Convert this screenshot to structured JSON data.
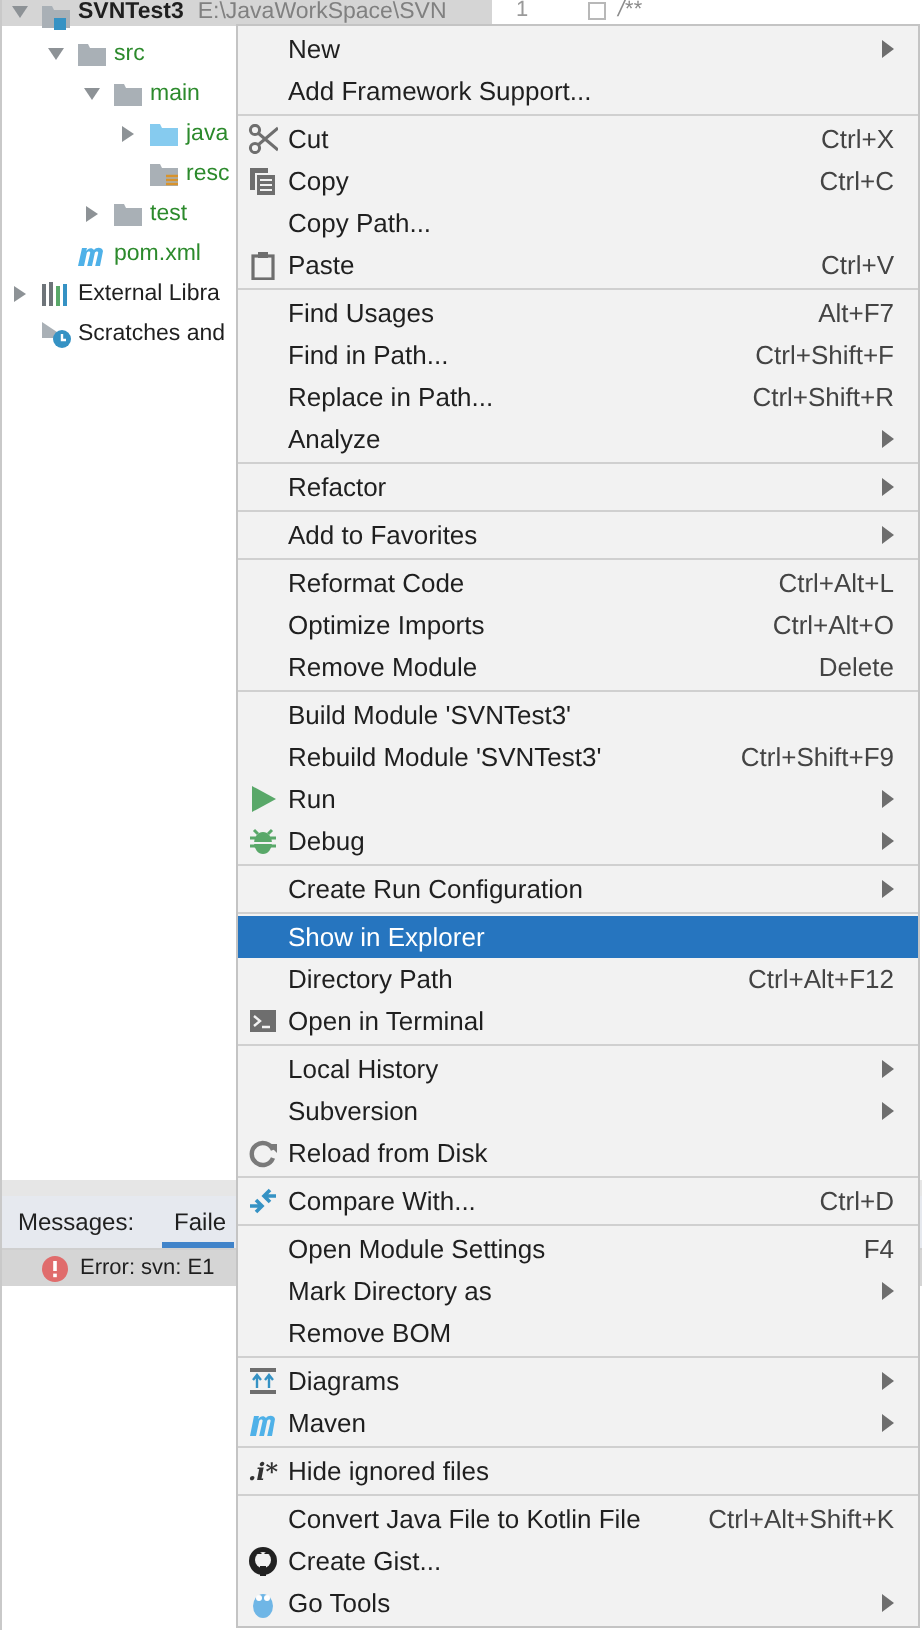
{
  "project_tree": [
    {
      "label": "SVNTest3",
      "path": "E:\\JavaWorkSpace\\SVN",
      "kind": "module",
      "color": "#1f1f1f",
      "expanded": true,
      "selected": true,
      "children": [
        {
          "label": "src",
          "kind": "folder",
          "color": "#2c8a2c",
          "expanded": true,
          "selected": false,
          "children": [
            {
              "label": "main",
              "kind": "folder",
              "color": "#2c8a2c",
              "expanded": true,
              "selected": false,
              "children": [
                {
                  "label": "java",
                  "kind": "source",
                  "color": "#2c8a2c",
                  "expanded": false,
                  "selected": false
                },
                {
                  "label": "resc",
                  "kind": "resources",
                  "color": "#2c8a2c",
                  "selected": false
                }
              ]
            },
            {
              "label": "test",
              "kind": "folder",
              "color": "#2c8a2c",
              "expanded": false,
              "selected": false
            }
          ]
        },
        {
          "label": "pom.xml",
          "kind": "maven",
          "color": "#2c8a2c",
          "selected": false
        }
      ]
    },
    {
      "label": "External Libra",
      "kind": "libraries",
      "color": "#1f1f1f",
      "expanded": false,
      "selected": false
    },
    {
      "label": "Scratches and",
      "kind": "scratches",
      "color": "#1f1f1f",
      "selected": false
    }
  ],
  "editor": {
    "line_number": "1",
    "code": "/**"
  },
  "messages_panel": {
    "title": "Messages:",
    "tabs": [
      {
        "label": "Faile",
        "selected": true
      }
    ],
    "rows": [
      {
        "kind": "error",
        "text": "Error: svn: E1",
        "selected": true
      }
    ]
  },
  "context_menu": {
    "groups": [
      [
        {
          "label": "New",
          "kind": "plain",
          "submenu": true,
          "selected": false
        },
        {
          "label": "Add Framework Support...",
          "kind": "plain",
          "submenu": false,
          "selected": false
        }
      ],
      [
        {
          "label": "Cut",
          "kind": "cut",
          "shortcut": "Ctrl+X",
          "submenu": false,
          "selected": false
        },
        {
          "label": "Copy",
          "kind": "copy",
          "shortcut": "Ctrl+C",
          "submenu": false,
          "selected": false
        },
        {
          "label": "Copy Path...",
          "kind": "plain",
          "submenu": false,
          "selected": false
        },
        {
          "label": "Paste",
          "kind": "paste",
          "shortcut": "Ctrl+V",
          "submenu": false,
          "selected": false
        }
      ],
      [
        {
          "label": "Find Usages",
          "shortcut": "Alt+F7",
          "submenu": false,
          "selected": false
        },
        {
          "label": "Find in Path...",
          "shortcut": "Ctrl+Shift+F",
          "submenu": false,
          "selected": false
        },
        {
          "label": "Replace in Path...",
          "shortcut": "Ctrl+Shift+R",
          "submenu": false,
          "selected": false
        },
        {
          "label": "Analyze",
          "submenu": true,
          "selected": false
        }
      ],
      [
        {
          "label": "Refactor",
          "submenu": true,
          "selected": false
        }
      ],
      [
        {
          "label": "Add to Favorites",
          "submenu": true,
          "selected": false
        }
      ],
      [
        {
          "label": "Reformat Code",
          "shortcut": "Ctrl+Alt+L",
          "submenu": false,
          "selected": false
        },
        {
          "label": "Optimize Imports",
          "shortcut": "Ctrl+Alt+O",
          "submenu": false,
          "selected": false
        },
        {
          "label": "Remove Module",
          "shortcut": "Delete",
          "submenu": false,
          "selected": false
        }
      ],
      [
        {
          "label": "Build Module 'SVNTest3'",
          "submenu": false,
          "selected": false
        },
        {
          "label": "Rebuild Module 'SVNTest3'",
          "shortcut": "Ctrl+Shift+F9",
          "submenu": false,
          "selected": false
        },
        {
          "label": "Run",
          "kind": "run",
          "submenu": true,
          "selected": false
        },
        {
          "label": "Debug",
          "kind": "debug",
          "submenu": true,
          "selected": false
        }
      ],
      [
        {
          "label": "Create Run Configuration",
          "submenu": true,
          "selected": false
        }
      ],
      [
        {
          "label": "Show in Explorer",
          "submenu": false,
          "selected": true
        },
        {
          "label": "Directory Path",
          "shortcut": "Ctrl+Alt+F12",
          "submenu": false,
          "selected": false
        },
        {
          "label": "Open in Terminal",
          "kind": "terminal",
          "submenu": false,
          "selected": false
        }
      ],
      [
        {
          "label": "Local History",
          "submenu": true,
          "selected": false
        },
        {
          "label": "Subversion",
          "submenu": true,
          "selected": false
        },
        {
          "label": "Reload from Disk",
          "kind": "reload",
          "submenu": false,
          "selected": false
        }
      ],
      [
        {
          "label": "Compare With...",
          "kind": "compare",
          "shortcut": "Ctrl+D",
          "submenu": false,
          "selected": false
        }
      ],
      [
        {
          "label": "Open Module Settings",
          "shortcut": "F4",
          "submenu": false,
          "selected": false
        },
        {
          "label": "Mark Directory as",
          "submenu": true,
          "selected": false
        },
        {
          "label": "Remove BOM",
          "submenu": false,
          "selected": false
        }
      ],
      [
        {
          "label": "Diagrams",
          "kind": "diagrams",
          "submenu": true,
          "selected": false
        },
        {
          "label": "Maven",
          "kind": "maven",
          "submenu": true,
          "selected": false
        }
      ],
      [
        {
          "label": "Hide ignored files",
          "kind": "glyph",
          "glyph": ".i*",
          "submenu": false,
          "selected": false
        }
      ],
      [
        {
          "label": "Convert Java File to Kotlin File",
          "shortcut": "Ctrl+Alt+Shift+K",
          "submenu": false,
          "selected": false
        },
        {
          "label": "Create Gist...",
          "kind": "gist",
          "submenu": false,
          "selected": false
        },
        {
          "label": "Go Tools",
          "kind": "gotools",
          "submenu": true,
          "selected": false
        }
      ]
    ]
  }
}
